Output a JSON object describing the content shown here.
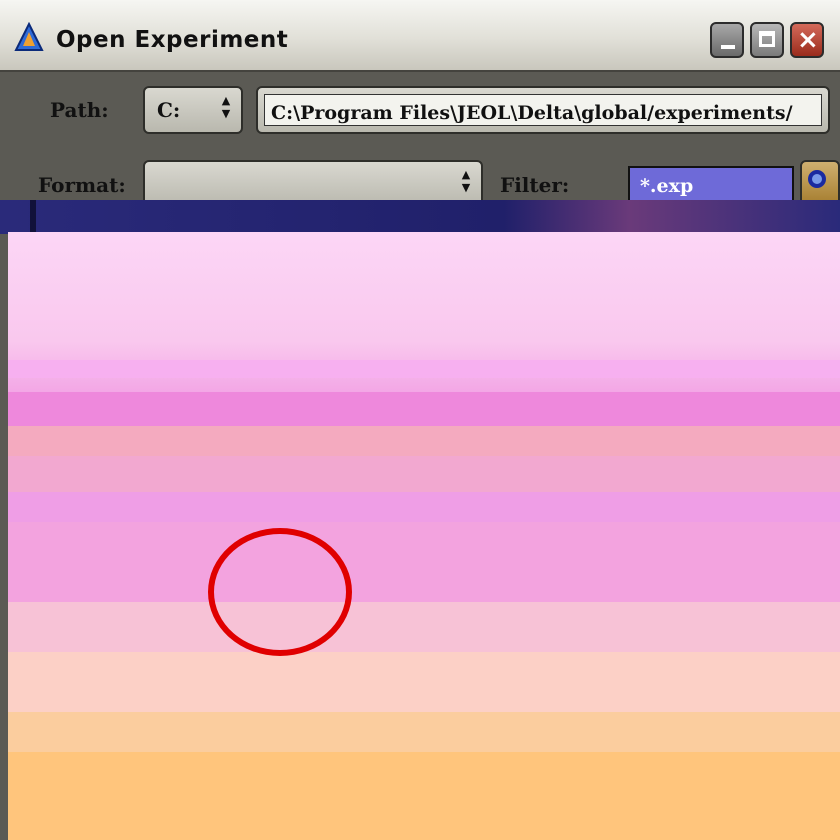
{
  "window": {
    "title": "Open Experiment",
    "icon": "delta-app-icon",
    "controls": {
      "minimize": "minimize-icon",
      "maximize": "maximize-icon",
      "close": "×"
    }
  },
  "path_row": {
    "label": "Path:",
    "drive": "C:",
    "drive_arrows": "▲▼",
    "path_value": "C:\\Program Files\\JEOL\\Delta\\global/experiments/"
  },
  "format_row": {
    "label": "Format:",
    "format_value": "",
    "format_arrows": "▲▼",
    "filter_label": "Filter:",
    "filter_value": "*.exp",
    "search_icon": "search-icon"
  },
  "colors": {
    "titlebar": "#e1e0d8",
    "window_body": "#5b5a54",
    "filter_bg": "#6e6ad8",
    "highlight_circle": "#e00000"
  }
}
